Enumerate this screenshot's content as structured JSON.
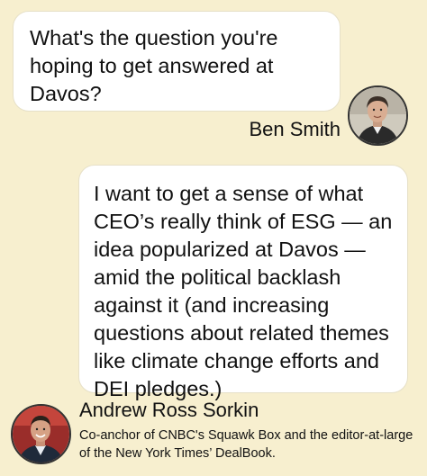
{
  "question": {
    "text": "What's the question you're hoping to get answered at Davos?",
    "speaker": "Ben Smith"
  },
  "answer": {
    "text": "I want to get a sense of what CEO’s really think of ESG — an idea popularized at Davos — amid the political backlash against it (and increasing questions about related themes like climate change efforts and DEI pledges.)",
    "speaker": "Andrew Ross Sorkin",
    "speaker_title": "Co-anchor of CNBC's Squawk Box and the editor-at-large of the New York Times’ DealBook."
  },
  "colors": {
    "background": "#f7efcf",
    "bubble": "#ffffff"
  }
}
